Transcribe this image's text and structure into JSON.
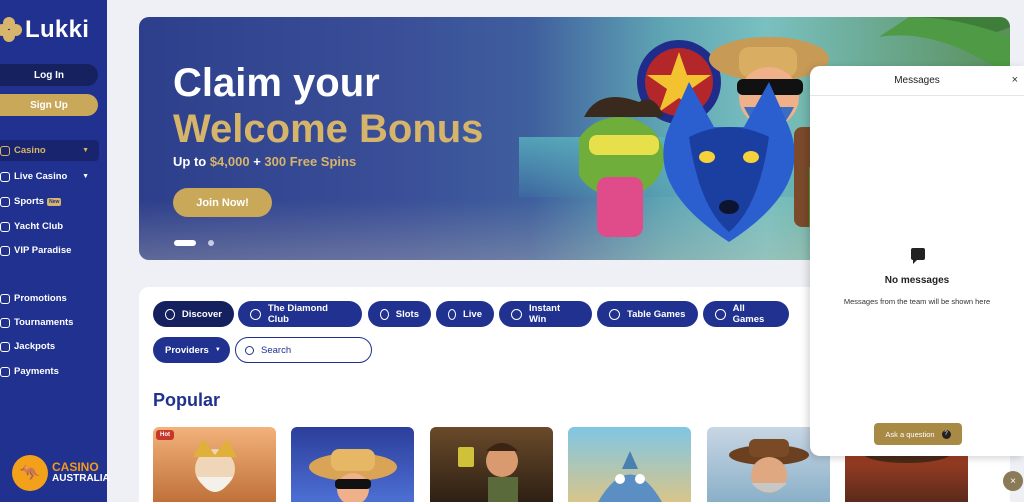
{
  "brand": {
    "name": "Lukki"
  },
  "auth": {
    "login_label": "Log In",
    "signup_label": "Sign Up"
  },
  "nav": {
    "casino": "Casino",
    "live_casino": "Live Casino",
    "sports": "Sports",
    "sports_badge": "New",
    "yacht_club": "Yacht Club",
    "vip_paradise": "VIP Paradise",
    "promotions": "Promotions",
    "tournaments": "Tournaments",
    "jackpots": "Jackpots",
    "payments": "Payments"
  },
  "watermark": {
    "line1": "CASINO",
    "line2": "AUSTRALIA"
  },
  "banner": {
    "headline1": "Claim your",
    "headline2": "Welcome Bonus",
    "sub_prefix": "Up to ",
    "sub_amount": "$4,000",
    "sub_mid": " + ",
    "sub_spins": "300 Free Spins",
    "cta": "Join Now!",
    "slide_count": 2,
    "active_slide": 1
  },
  "categories": {
    "discover": "Discover",
    "diamond_club": "The Diamond Club",
    "slots": "Slots",
    "live": "Live",
    "instant_win": "Instant Win",
    "table_games": "Table Games",
    "all_games": "All Games"
  },
  "filters": {
    "providers": "Providers",
    "search_placeholder": "Search"
  },
  "popular": {
    "title": "Popular",
    "hot_badge": "Hot"
  },
  "messages": {
    "title": "Messages",
    "close": "×",
    "empty_title": "No messages",
    "empty_sub": "Messages from the team will be shown here",
    "ask_label": "Ask a question",
    "ask_icon": "?"
  },
  "fab": {
    "close": "×"
  },
  "colors": {
    "primary": "#20318f",
    "gold": "#c9a85a",
    "hot": "#c8362a"
  }
}
